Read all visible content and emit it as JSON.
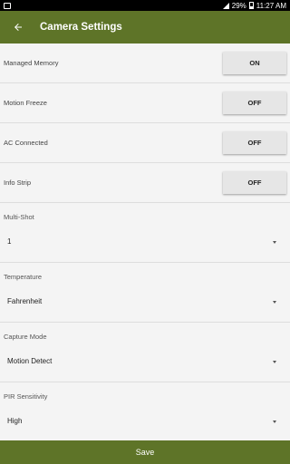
{
  "status_bar": {
    "battery_percent": "29%",
    "time": "11:27 AM",
    "icons": [
      "message-icon",
      "signal-icon",
      "battery-icon"
    ]
  },
  "toolbar": {
    "title": "Camera Settings",
    "back_icon": "back-arrow-icon"
  },
  "toggles": [
    {
      "label": "Managed Memory",
      "value": "ON"
    },
    {
      "label": "Motion Freeze",
      "value": "OFF"
    },
    {
      "label": "AC Connected",
      "value": "OFF"
    },
    {
      "label": "Info Strip",
      "value": "OFF"
    }
  ],
  "selects": [
    {
      "label": "Multi-Shot",
      "value": "1"
    },
    {
      "label": "Temperature",
      "value": "Fahrenheit"
    },
    {
      "label": "Capture Mode",
      "value": "Motion Detect"
    },
    {
      "label": "PIR Sensitivity",
      "value": "High"
    }
  ],
  "footer": {
    "save_label": "Save"
  },
  "colors": {
    "toolbar": "#5e7428",
    "button": "#e6e6e6",
    "background": "#f4f4f4"
  }
}
